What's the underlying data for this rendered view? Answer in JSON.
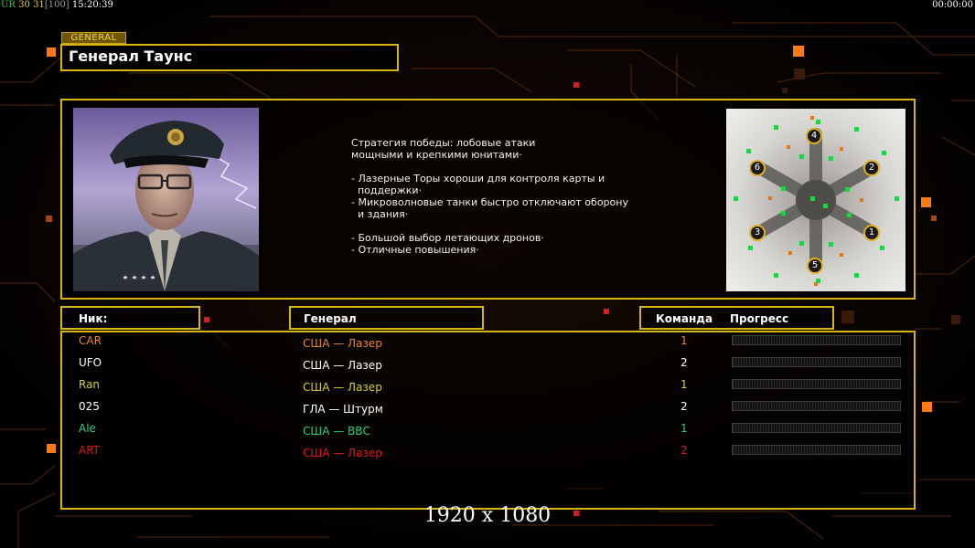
{
  "hud": {
    "left_prefix": "UR",
    "left_a": "30",
    "left_b": "31",
    "left_bracket": "[100]",
    "left_time": "15:20:39",
    "right_time": "00:00:00"
  },
  "general": {
    "ribbon": "GENERAL",
    "name": "Генерал Таунс",
    "description": "Стратегия победы: лобовые атаки\nмощными и крепкими юнитами·\n\n- Лазерные Торы хороши для контроля карты и\n  поддержки·\n- Микроволновые танки быстро отключают оборону\n  и здания·\n\n- Большой выбор летающих дронов·\n- Отличные повышения·"
  },
  "map": {
    "slots": [
      "4",
      "6",
      "2",
      "3",
      "1",
      "5"
    ]
  },
  "table": {
    "headers": {
      "nick": "Ник:",
      "general": "Генерал",
      "team": "Команда",
      "progress": "Прогресс"
    },
    "rows": [
      {
        "nick": "CAR",
        "general": "США — Лазер",
        "team": "1",
        "color": "#e8862a"
      },
      {
        "nick": "UFO",
        "general": "США — Лазер",
        "team": "2",
        "color": "#ffffff"
      },
      {
        "nick": "Ran",
        "general": "США — Лазер",
        "team": "1",
        "color": "#d8cf2a"
      },
      {
        "nick": "025",
        "general": "ГЛА — Штурм",
        "team": "2",
        "color": "#ffffff"
      },
      {
        "nick": "Ale",
        "general": "США — ВВС",
        "team": "1",
        "color": "#1fd27a"
      },
      {
        "nick": "ART",
        "general": "США — Лазер",
        "team": "2",
        "color": "#e01818"
      }
    ]
  },
  "footer": {
    "resolution": "1920 x 1080"
  },
  "colors": {
    "frame": "#d8b414",
    "accent_orange": "#ff7a14",
    "background": "#000000"
  }
}
